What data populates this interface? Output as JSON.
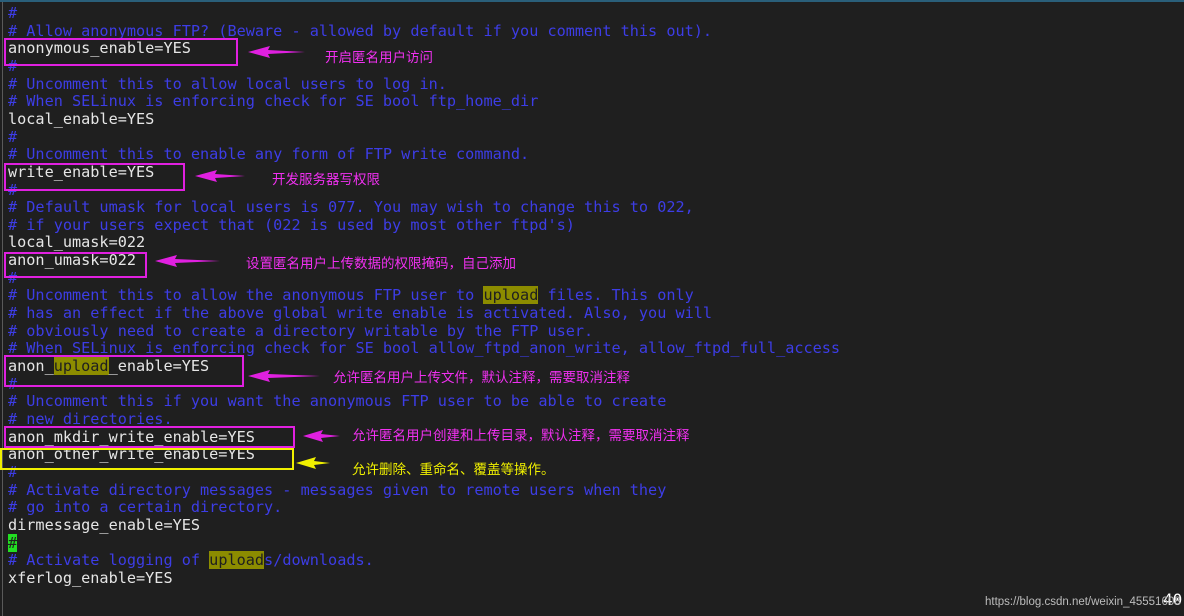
{
  "editor": {
    "lines": [
      [
        {
          "t": "#",
          "c": "comment"
        }
      ],
      [
        {
          "t": "# Allow anonymous FTP? (Beware - allowed by default if you comment this out).",
          "c": "comment"
        }
      ],
      [
        {
          "t": "anonymous_enable=YES",
          "c": "code"
        }
      ],
      [
        {
          "t": "#",
          "c": "comment"
        }
      ],
      [
        {
          "t": "# Uncomment this to allow local users to log in.",
          "c": "comment"
        }
      ],
      [
        {
          "t": "# When SELinux is enforcing check for SE bool ftp_home_dir",
          "c": "comment"
        }
      ],
      [
        {
          "t": "local_enable=YES",
          "c": "code"
        }
      ],
      [
        {
          "t": "#",
          "c": "comment"
        }
      ],
      [
        {
          "t": "# Uncomment this to enable any form of FTP write command.",
          "c": "comment"
        }
      ],
      [
        {
          "t": "write_enable=YES",
          "c": "code"
        }
      ],
      [
        {
          "t": "#",
          "c": "comment"
        }
      ],
      [
        {
          "t": "# Default umask for local users is 077. You may wish to change this to 022,",
          "c": "comment"
        }
      ],
      [
        {
          "t": "# if your users expect that (022 is used by most other ftpd's)",
          "c": "comment"
        }
      ],
      [
        {
          "t": "local_umask=022",
          "c": "code"
        }
      ],
      [
        {
          "t": "anon_umask=022",
          "c": "code"
        }
      ],
      [
        {
          "t": "#",
          "c": "comment"
        }
      ],
      [
        {
          "t": "# Uncomment this to allow the anonymous FTP user to ",
          "c": "comment"
        },
        {
          "t": "upload",
          "c": "hl"
        },
        {
          "t": " files. This only",
          "c": "comment"
        }
      ],
      [
        {
          "t": "# has an effect if the above global write enable is activated. Also, you will",
          "c": "comment"
        }
      ],
      [
        {
          "t": "# obviously need to create a directory writable by the FTP user.",
          "c": "comment"
        }
      ],
      [
        {
          "t": "# When SELinux is enforcing check for SE bool allow_ftpd_anon_write, allow_ftpd_full_access",
          "c": "comment"
        }
      ],
      [
        {
          "t": "anon_",
          "c": "code"
        },
        {
          "t": "upload",
          "c": "hl"
        },
        {
          "t": "_enable=YES",
          "c": "code"
        }
      ],
      [
        {
          "t": "#",
          "c": "comment"
        }
      ],
      [
        {
          "t": "# Uncomment this if you want the anonymous FTP user to be able to create",
          "c": "comment"
        }
      ],
      [
        {
          "t": "# new directories.",
          "c": "comment"
        }
      ],
      [
        {
          "t": "anon_mkdir_write_enable=YES",
          "c": "code"
        }
      ],
      [
        {
          "t": "anon_other_write_enable=YES",
          "c": "code"
        }
      ],
      [
        {
          "t": "#",
          "c": "comment"
        }
      ],
      [
        {
          "t": "# Activate directory messages - messages given to remote users when they",
          "c": "comment"
        }
      ],
      [
        {
          "t": "# go into a certain directory.",
          "c": "comment"
        }
      ],
      [
        {
          "t": "dirmessage_enable=YES",
          "c": "code"
        }
      ],
      [
        {
          "t": "#",
          "c": "cursor"
        }
      ],
      [
        {
          "t": "# Activate logging of ",
          "c": "comment"
        },
        {
          "t": "upload",
          "c": "hl"
        },
        {
          "t": "s/downloads.",
          "c": "comment"
        }
      ],
      [
        {
          "t": "xferlog_enable=YES",
          "c": "code"
        }
      ]
    ],
    "line_number": "40"
  },
  "annotations": [
    {
      "text": "开启匿名用户访问",
      "color": "#e020e0"
    },
    {
      "text": "开发服务器写权限",
      "color": "#e020e0"
    },
    {
      "text": "设置匿名用户上传数据的权限掩码，自己添加",
      "color": "#e020e0"
    },
    {
      "text": "允许匿名用户上传文件，默认注释，需要取消注释",
      "color": "#e020e0"
    },
    {
      "text": "允许匿名用户创建和上传目录，默认注释，需要取消注释",
      "color": "#e020e0"
    },
    {
      "text": "允许删除、重命名、覆盖等操作。",
      "color": "#f0f000"
    }
  ],
  "watermark": "https://blog.csdn.net/weixin_45551608",
  "colors": {
    "background": "#1f1f1f",
    "comment": "#3d3de6",
    "code": "#e6e6e6",
    "search_highlight": "#8c8c00",
    "cursor": "#22e022"
  }
}
